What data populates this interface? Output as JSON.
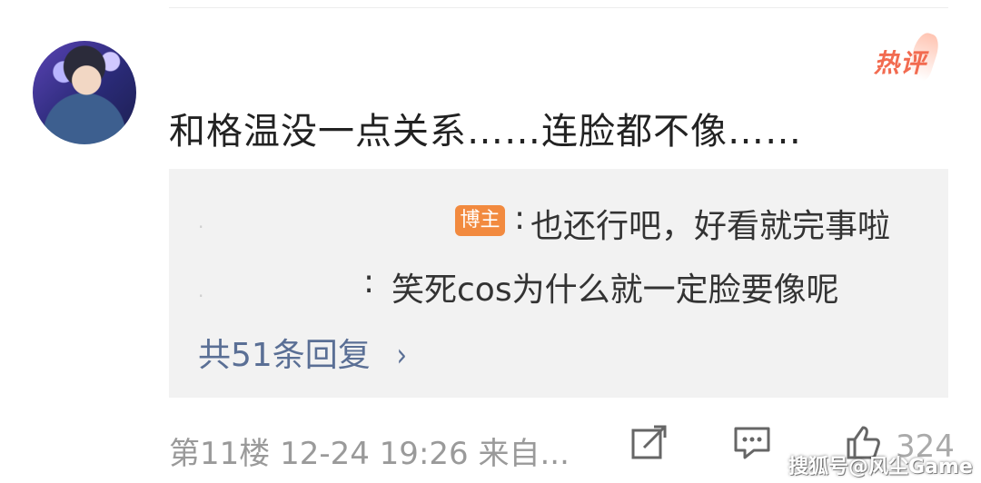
{
  "comment": {
    "text": "和格温没一点关系……连脸都不像……",
    "badge_text": "热评",
    "reply_preview": {
      "reply_1": {
        "author_tag": "博主",
        "colon": ":",
        "text": "也还行吧，好看就完事啦"
      },
      "reply_2": {
        "colon": ":",
        "text": "笑死cos为什么就一定脸要像呢"
      },
      "more_replies_label": "共51条回复",
      "more_replies_chevron": "›"
    },
    "footer": {
      "meta": "第11楼 12-24 19:26 来自...",
      "share_icon": "share-icon",
      "comment_icon": "comment-icon",
      "like_icon": "thumbs-up-icon",
      "like_count": "324",
      "watermark": "搜狐号@风尘Game"
    }
  }
}
